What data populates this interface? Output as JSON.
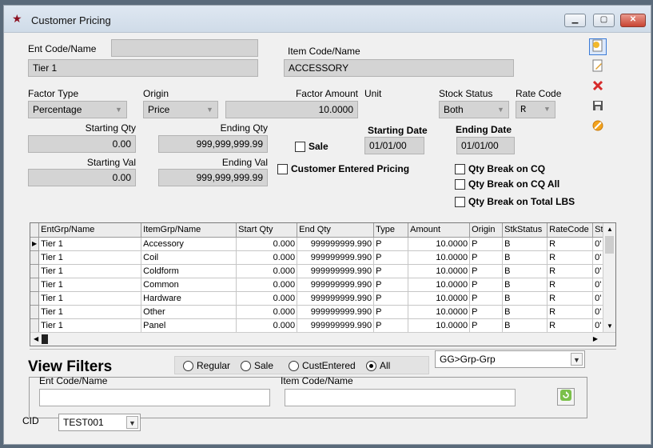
{
  "window": {
    "title": "Customer Pricing",
    "min": "▁",
    "max": "▢",
    "close": "✕"
  },
  "form": {
    "ent_code_label": "Ent Code/Name",
    "ent_code_value": "",
    "ent_name_value": "Tier 1",
    "item_code_label": "Item Code/Name",
    "item_code_value": "ACCESSORY",
    "factor_type_label": "Factor Type",
    "factor_type_value": "Percentage",
    "origin_label": "Origin",
    "origin_value": "Price",
    "factor_amount_label": "Factor Amount",
    "factor_amount_value": "10.0000",
    "unit_label": "Unit",
    "stock_status_label": "Stock Status",
    "stock_status_value": "Both",
    "rate_code_label": "Rate Code",
    "rate_code_value": "R",
    "starting_qty_label": "Starting Qty",
    "starting_qty_value": "0.00",
    "ending_qty_label": "Ending Qty",
    "ending_qty_value": "999,999,999.99",
    "starting_val_label": "Starting Val",
    "starting_val_value": "0.00",
    "ending_val_label": "Ending Val",
    "ending_val_value": "999,999,999.99",
    "sale_label": "Sale",
    "starting_date_label": "Starting Date",
    "starting_date_value": "01/01/00",
    "ending_date_label": "Ending Date",
    "ending_date_value": "01/01/00",
    "customer_entered_label": "Customer Entered Pricing",
    "qty_break_cq_label": "Qty Break on CQ",
    "qty_break_cq_all_label": "Qty Break on CQ All",
    "qty_break_lbs_label": "Qty Break on Total LBS"
  },
  "toolbar": {
    "new_icon": "new-record-icon",
    "edit_icon": "edit-icon",
    "delete_icon": "delete-icon",
    "save_icon": "save-icon",
    "cancel_icon": "cancel-icon"
  },
  "grid": {
    "columns": [
      "EntGrp/Name",
      "ItemGrp/Name",
      "Start Qty",
      "End Qty",
      "Type",
      "Amount",
      "Origin",
      "StkStatus",
      "RateCode",
      "St"
    ],
    "rows": [
      [
        "Tier 1",
        "Accessory",
        "0.000",
        "999999999.990",
        "P",
        "10.0000",
        "P",
        "B",
        "R",
        "0'"
      ],
      [
        "Tier 1",
        "Coil",
        "0.000",
        "999999999.990",
        "P",
        "10.0000",
        "P",
        "B",
        "R",
        "0'"
      ],
      [
        "Tier 1",
        "Coldform",
        "0.000",
        "999999999.990",
        "P",
        "10.0000",
        "P",
        "B",
        "R",
        "0'"
      ],
      [
        "Tier 1",
        "Common",
        "0.000",
        "999999999.990",
        "P",
        "10.0000",
        "P",
        "B",
        "R",
        "0'"
      ],
      [
        "Tier 1",
        "Hardware",
        "0.000",
        "999999999.990",
        "P",
        "10.0000",
        "P",
        "B",
        "R",
        "0'"
      ],
      [
        "Tier 1",
        "Other",
        "0.000",
        "999999999.990",
        "P",
        "10.0000",
        "P",
        "B",
        "R",
        "0'"
      ],
      [
        "Tier 1",
        "Panel",
        "0.000",
        "999999999.990",
        "P",
        "10.0000",
        "P",
        "B",
        "R",
        "0'"
      ]
    ]
  },
  "filters": {
    "title": "View Filters",
    "radio_regular": "Regular",
    "radio_sale": "Sale",
    "radio_cust_entered": "CustEntered",
    "radio_all": "All",
    "group_select_value": "GG>Grp-Grp",
    "ent_code_label": "Ent Code/Name",
    "item_code_label": "Item Code/Name",
    "ent_code_value": "",
    "item_code_value": ""
  },
  "cid": {
    "label": "CID",
    "value": "TEST001"
  }
}
